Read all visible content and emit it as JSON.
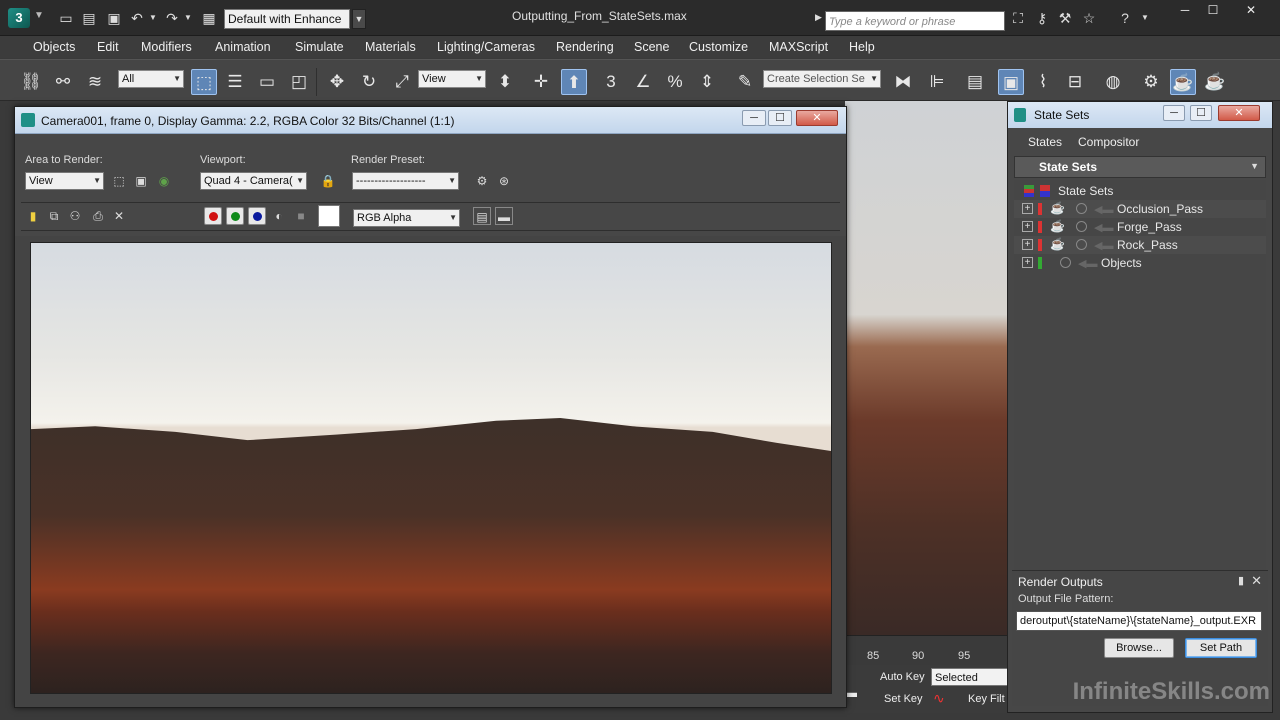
{
  "app": {
    "workspace": "Default with Enhance",
    "document_title": "Outputting_From_StateSets.max",
    "search_placeholder": "Type a keyword or phrase"
  },
  "menu": [
    "Objects",
    "Edit",
    "Modifiers",
    "Animation",
    "Simulate",
    "Materials",
    "Lighting/Cameras",
    "Rendering",
    "Scene",
    "Customize",
    "MAXScript",
    "Help"
  ],
  "toolbar": {
    "selection_filter": "All",
    "reference_coord": "View",
    "named_selection_placeholder": "Create Selection Se",
    "snap_label": "3"
  },
  "render_window": {
    "title": "Camera001, frame 0, Display Gamma: 2.2, RGBA Color 32 Bits/Channel (1:1)",
    "area_to_render_label": "Area to Render:",
    "area_to_render_value": "View",
    "viewport_label": "Viewport:",
    "viewport_value": "Quad 4 - Camera(",
    "render_preset_label": "Render Preset:",
    "render_preset_value": "-------------------",
    "channel_display": "RGB Alpha"
  },
  "timeline": {
    "ticks": [
      "85",
      "90",
      "95"
    ],
    "auto_key": "Auto Key",
    "set_key": "Set Key",
    "key_mode": "Selected",
    "key_filters": "Key Filt"
  },
  "state_sets": {
    "title": "State Sets",
    "menu": [
      "States",
      "Compositor"
    ],
    "header": "State Sets",
    "root": "State Sets",
    "items": [
      {
        "label": "Occlusion_Pass"
      },
      {
        "label": "Forge_Pass"
      },
      {
        "label": "Rock_Pass"
      },
      {
        "label": "Objects"
      }
    ],
    "render_outputs": {
      "title": "Render Outputs",
      "pattern_label": "Output File Pattern:",
      "pattern_value": "deroutput\\{stateName}\\{stateName}_output.EXR",
      "browse": "Browse...",
      "set_path": "Set Path"
    }
  },
  "watermark": "InfiniteSkills.com",
  "colors": {
    "accent": "#5f86b6",
    "red_channel": "#d01010",
    "green_channel": "#0f8a1a",
    "blue_channel": "#0a1a9e"
  }
}
